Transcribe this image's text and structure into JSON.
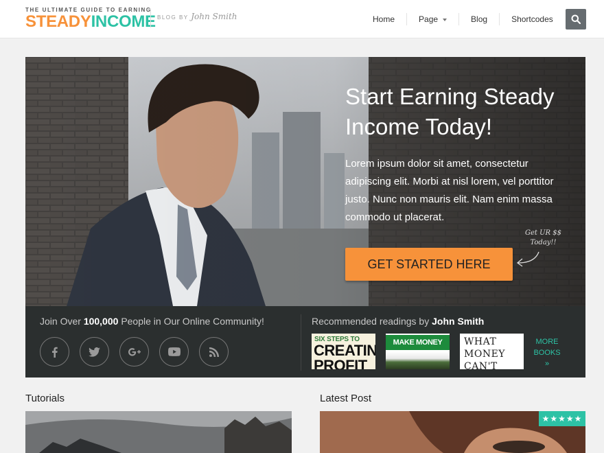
{
  "header": {
    "tagline": "THE ULTIMATE GUIDE TO EARNING",
    "logo_part1": "STEADY",
    "logo_part2": "INCOME",
    "blog_by": "BLOG BY",
    "author": "John Smith"
  },
  "nav": {
    "items": [
      {
        "label": "Home"
      },
      {
        "label": "Page",
        "has_dropdown": true
      },
      {
        "label": "Blog"
      },
      {
        "label": "Shortcodes"
      }
    ],
    "search_icon": "search-icon"
  },
  "hero": {
    "title": "Start Earning Steady Income Today!",
    "body": "Lorem ipsum dolor sit amet, consectetur adipiscing elit. Morbi at nisl lorem, vel porttitor justo. Nunc non mauris elit. Nam enim massa commodo ut placerat.",
    "cta_label": "GET STARTED HERE",
    "handnote_line1": "Get UR $$",
    "handnote_line2": "Today!!"
  },
  "community": {
    "join_prefix": "Join Over",
    "join_count": "100,000",
    "join_suffix": "People in Our Online Community!",
    "social_icons": [
      "facebook-icon",
      "twitter-icon",
      "google-plus-icon",
      "youtube-icon",
      "rss-icon"
    ],
    "rec_prefix": "Recommended readings by",
    "rec_author": "John Smith",
    "books": [
      {
        "line1": "SIX STEPS TO",
        "line2": "CREATING",
        "line3": "PROFIT"
      },
      {
        "line1": "MAKE MONEY ONLINE"
      },
      {
        "line1": "WHAT",
        "line2": "MONEY",
        "line3": "CAN'T"
      }
    ],
    "more_books_line1": "MORE",
    "more_books_line2": "BOOKS",
    "more_books_arrow": "»"
  },
  "sections": {
    "tutorials_title": "Tutorials",
    "latest_post_title": "Latest Post",
    "rating_stars": "★★★★★"
  },
  "colors": {
    "accent_orange": "#f7923a",
    "accent_teal": "#2dc2a5",
    "dark_bar": "#2b2f2f"
  }
}
